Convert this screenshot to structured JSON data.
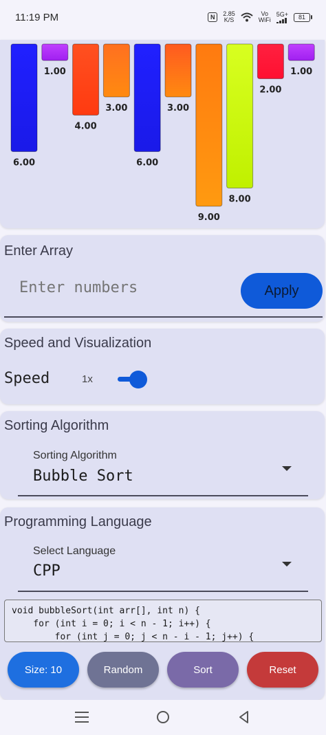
{
  "status_bar": {
    "time": "11:19 PM",
    "net_speed_value": "2.85",
    "net_speed_unit": "K/S",
    "vowifi_top": "Vo",
    "vowifi_bottom": "WiFi",
    "network": "5G+",
    "battery": "81",
    "nfc_label": "N"
  },
  "visualizer": {
    "bars": [
      {
        "value": 6.0,
        "label": "6.00",
        "color_top": "#2020ff",
        "color_bottom": "#1a1ae8"
      },
      {
        "value": 1.0,
        "label": "1.00",
        "color_top": "#c040ff",
        "color_bottom": "#a020f0"
      },
      {
        "value": 4.0,
        "label": "4.00",
        "color_top": "#ff5020",
        "color_bottom": "#ff3a10"
      },
      {
        "value": 3.0,
        "label": "3.00",
        "color_top": "#ff7020",
        "color_bottom": "#ff8a10"
      },
      {
        "value": 6.0,
        "label": "6.00",
        "color_top": "#2020ff",
        "color_bottom": "#1a1ae8"
      },
      {
        "value": 3.0,
        "label": "3.00",
        "color_top": "#ff5a20",
        "color_bottom": "#ff8a10"
      },
      {
        "value": 9.0,
        "label": "9.00",
        "color_top": "#ff7a10",
        "color_bottom": "#ff9a10"
      },
      {
        "value": 8.0,
        "label": "8.00",
        "color_top": "#d8ff20",
        "color_bottom": "#c0f000"
      },
      {
        "value": 2.0,
        "label": "2.00",
        "color_top": "#ff2040",
        "color_bottom": "#ff1030"
      },
      {
        "value": 1.0,
        "label": "1.00",
        "color_top": "#c040ff",
        "color_bottom": "#a020f0"
      }
    ],
    "max_value": 9.0
  },
  "array_section": {
    "title": "Enter Array",
    "input_placeholder": "Enter numbers",
    "apply_label": "Apply"
  },
  "speed_section": {
    "title": "Speed and Visualization",
    "speed_label": "Speed",
    "speed_value": "1x"
  },
  "sorting_section": {
    "title": "Sorting Algorithm",
    "caption": "Sorting Algorithm",
    "selected": "Bubble Sort"
  },
  "language_section": {
    "title": "Programming Language",
    "caption": "Select Language",
    "selected": "CPP",
    "code_lines": [
      "void bubbleSort(int arr[], int n) {",
      "    for (int i = 0; i < n - 1; i++) {",
      "        for (int j = 0; j < n - i - 1; j++) {"
    ]
  },
  "actions": {
    "size_label": "Size: 10",
    "random_label": "Random",
    "sort_label": "Sort",
    "reset_label": "Reset"
  },
  "colors": {
    "accent": "#0f5ad9",
    "size_button": "#1e6fe0",
    "random_button": "#6f7394",
    "sort_button": "#7a6aa8",
    "reset_button": "#c43a3a"
  }
}
